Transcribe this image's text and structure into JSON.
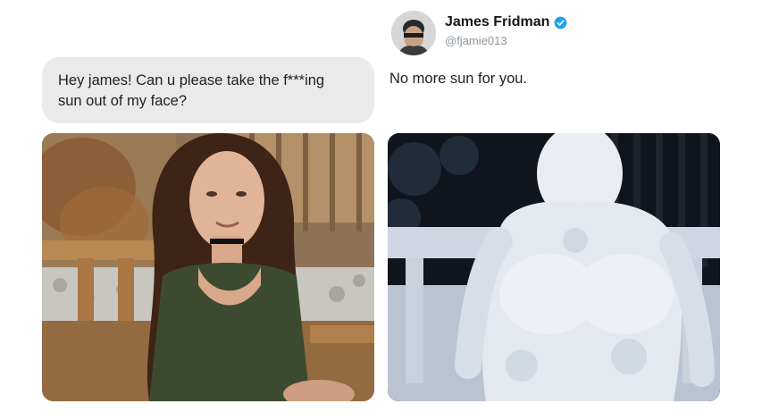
{
  "request": {
    "line1": "Hey james! Can u please take the f***ing",
    "line2": "sun out of my face?"
  },
  "tweet": {
    "author_name": "James Fridman",
    "author_handle": "@fjamie013",
    "verified_icon": "verified-badge-icon",
    "text": "No more sun for you."
  },
  "colors": {
    "bubble_bg": "#eaeaea",
    "verified_blue": "#1da1f2"
  }
}
